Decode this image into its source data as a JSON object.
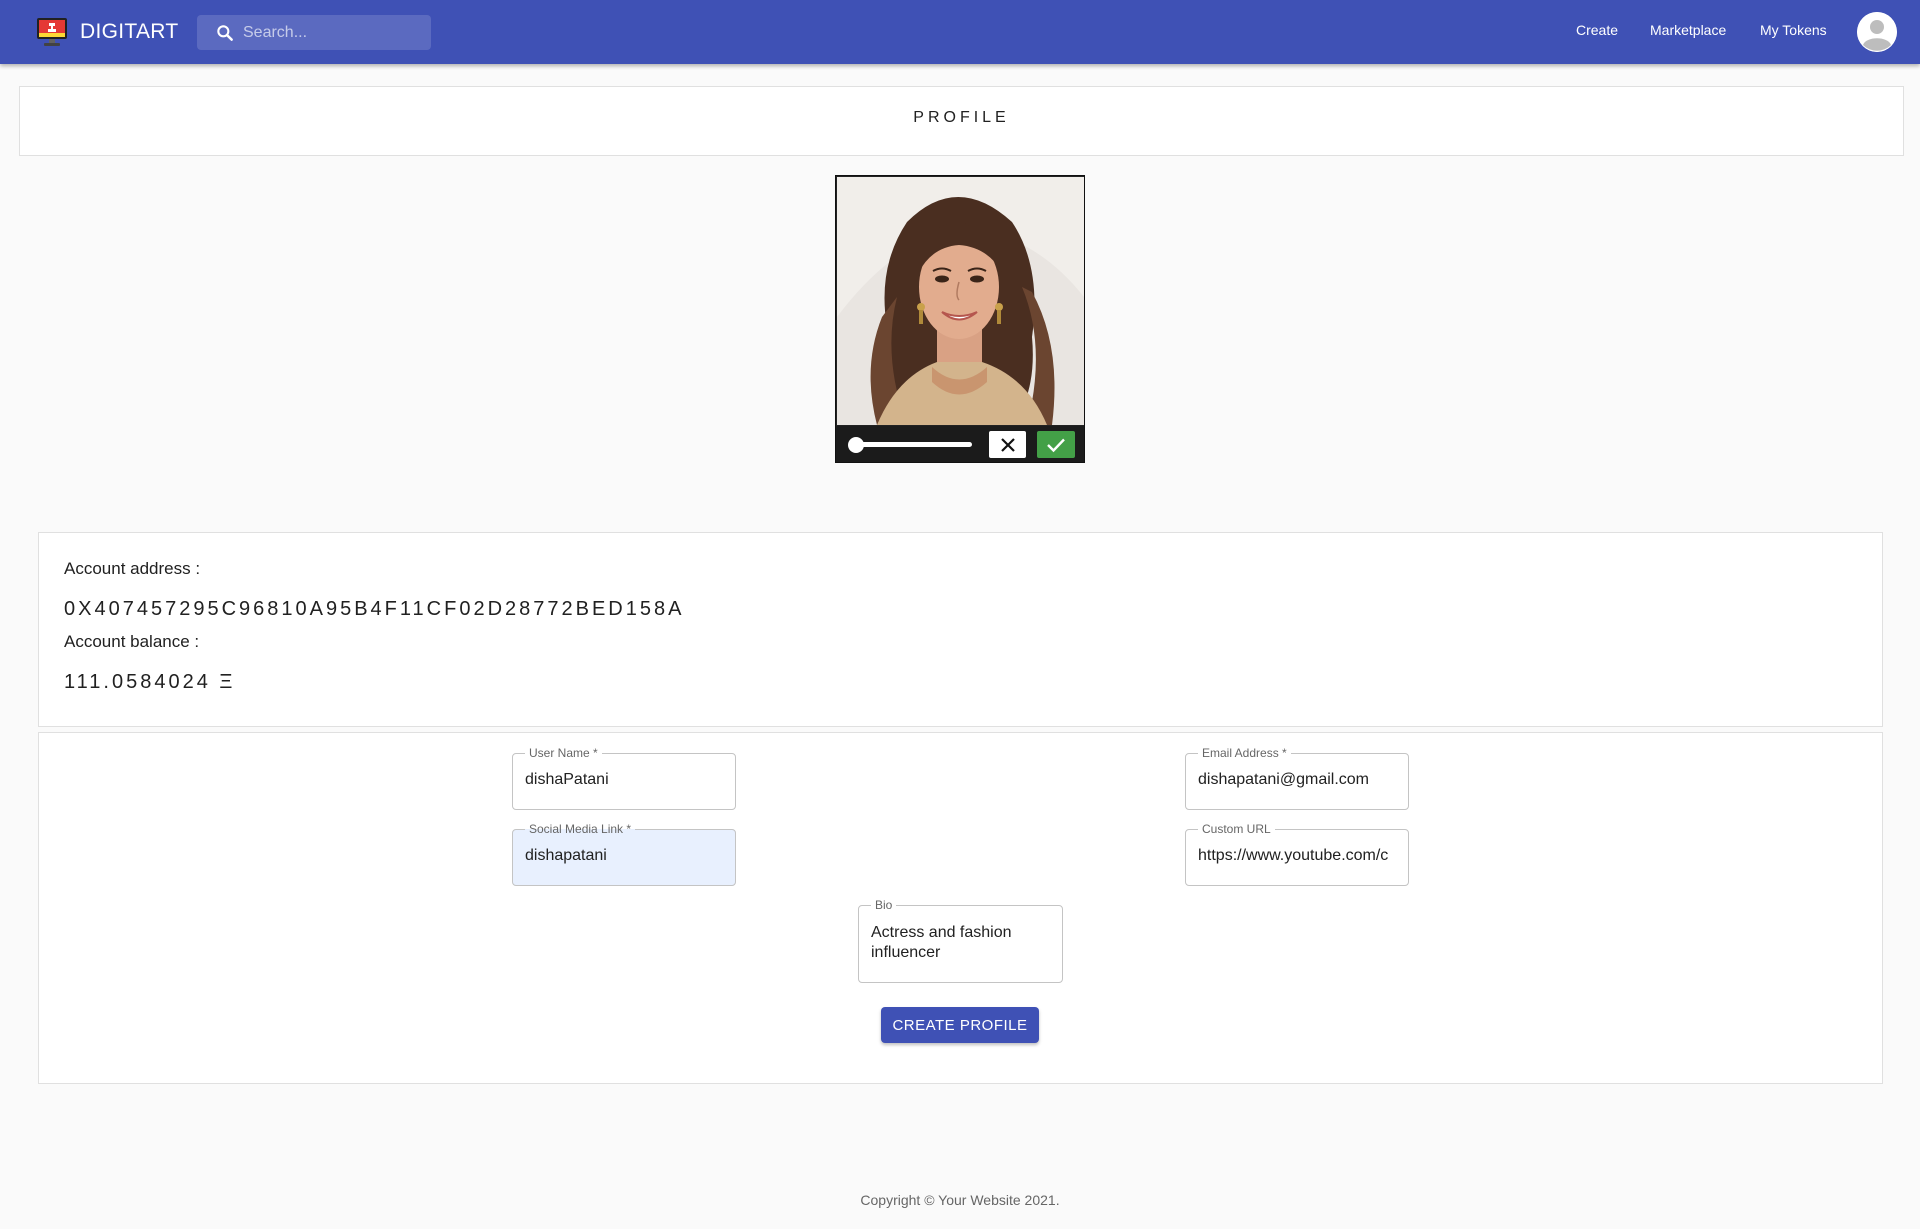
{
  "header": {
    "brand": "DIGITART",
    "search_placeholder": "Search...",
    "nav": [
      "Create",
      "Marketplace",
      "My Tokens"
    ]
  },
  "profile": {
    "title": "PROFILE"
  },
  "editor": {
    "zoom_level": 0
  },
  "account": {
    "address_label": "Account address :",
    "address": "0X407457295C96810A95B4F11CF02D28772BED158A",
    "balance_label": "Account balance :",
    "balance": "111.0584024 Ξ"
  },
  "form": {
    "user_name": {
      "label": "User Name *",
      "value": "dishaPatani"
    },
    "email": {
      "label": "Email Address *",
      "value": "dishapatani@gmail.com"
    },
    "social": {
      "label": "Social Media Link *",
      "value": "dishapatani"
    },
    "custom_url": {
      "label": "Custom URL",
      "value": "https://www.youtube.com/c"
    },
    "bio": {
      "label": "Bio",
      "value": "Actress and fashion influencer"
    },
    "submit_label": "CREATE PROFILE"
  },
  "footer": {
    "copyright": "Copyright © Your Website 2021."
  },
  "colors": {
    "primary": "#3f51b5",
    "success": "#43a047",
    "autofill": "#e8f0fe"
  }
}
